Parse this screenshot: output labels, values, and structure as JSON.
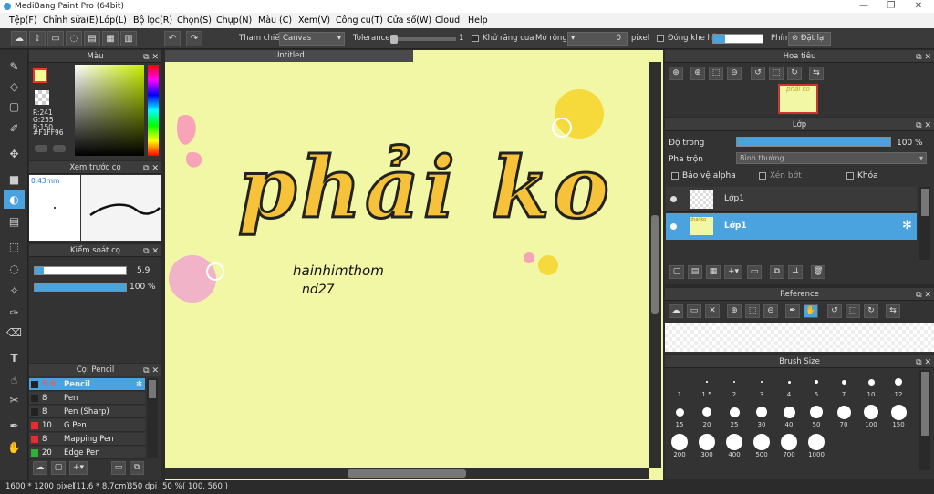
{
  "app": {
    "title": "MediBang Paint Pro (64bit)"
  },
  "menu": [
    "Tệp(F)",
    "Chỉnh sửa(E)",
    "Lớp(L)",
    "Bộ lọc(R)",
    "Chọn(S)",
    "Chụp(N)",
    "Màu (C)",
    "Xem(V)",
    "Công cụ(T)",
    "Cửa sổ(W)",
    "Cloud",
    "Help"
  ],
  "toolbar": {
    "reference_label": "Tham chiếu",
    "reference_value": "Canvas",
    "tolerance_label": "Tolerance",
    "tolerance_value": "1",
    "antialias_label": "Khử răng cưa",
    "expand_label": "Mở rộng",
    "expand_value": "0",
    "expand_unit": "pixel",
    "close_gap_label": "Đóng khe hở",
    "key_label": "Phím",
    "reset_label": "Đặt lại"
  },
  "color_panel": {
    "title": "Màu",
    "r": "R:241",
    "g": "G:255",
    "b": "B:150",
    "hex": "#F1FF96",
    "fg_color": "#F1FF96"
  },
  "brush_preview": {
    "title": "Xem trước cọ",
    "size": "0.43mm"
  },
  "brush_control": {
    "title": "Kiểm soát cọ",
    "size_value": "5.9",
    "opacity_value": "100 %"
  },
  "brush_list": {
    "title": "Cọ: Pencil",
    "items": [
      {
        "size": "5.9",
        "name": "Pencil",
        "color": "#222222"
      },
      {
        "size": "8",
        "name": "Pen",
        "color": "#222222"
      },
      {
        "size": "8",
        "name": "Pen (Sharp)",
        "color": "#222222"
      },
      {
        "size": "10",
        "name": "G Pen",
        "color": "#e03030"
      },
      {
        "size": "8",
        "name": "Mapping Pen",
        "color": "#e03030"
      },
      {
        "size": "20",
        "name": "Edge Pen",
        "color": "#30b030"
      }
    ]
  },
  "document": {
    "tab": "Untitled",
    "lettering": "phải ko",
    "handwriting_1": "hainhimthom",
    "handwriting_2": "nd27",
    "bg_color": "#F2F7A6"
  },
  "navigator": {
    "title": "Hoa tiêu"
  },
  "layers": {
    "title": "Lớp",
    "opacity_label": "Độ trong",
    "opacity_value": "100 %",
    "blend_label": "Pha trộn",
    "blend_value": "Bình thường",
    "protect_alpha": "Bảo vệ alpha",
    "clipping": "Xén bớt",
    "lock": "Khóa",
    "items": [
      {
        "name": "Lớp1"
      },
      {
        "name": "Lớp1"
      }
    ]
  },
  "reference": {
    "title": "Reference"
  },
  "brush_size": {
    "title": "Brush Size",
    "sizes": [
      "1",
      "1.5",
      "2",
      "3",
      "4",
      "5",
      "7",
      "10",
      "12",
      "15",
      "20",
      "25",
      "30",
      "40",
      "50",
      "70",
      "100",
      "150",
      "200",
      "300",
      "400",
      "500",
      "700",
      "1000"
    ]
  },
  "status": {
    "size": "1600 * 1200 pixel",
    "phys": "(11.6 * 8.7cm)",
    "dpi": "350 dpi",
    "zoom": "50 %",
    "coords": "( 100, 560 )"
  }
}
